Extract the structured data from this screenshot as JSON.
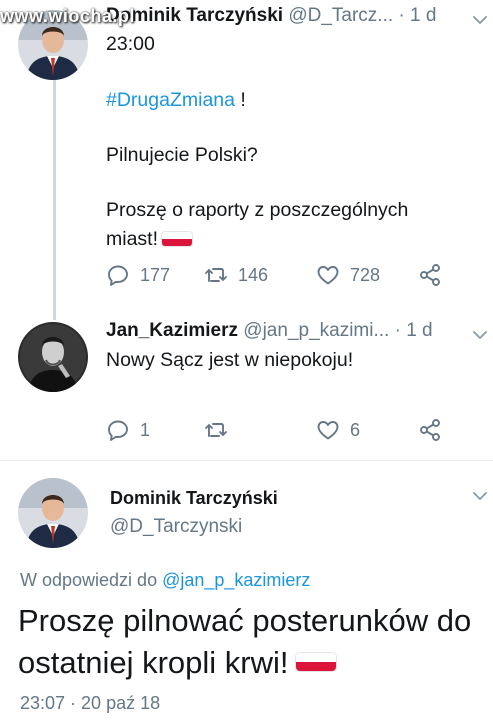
{
  "watermark": "www.wiocha.pl",
  "tweet1": {
    "name": "Dominik Tarczyński",
    "handle": "@D_Tarcz...",
    "age": "· 1 d",
    "time": "23:00",
    "hashtag": "#DrugaZmiana",
    "hashtag_suffix": " !",
    "line2": "Pilnujecie Polski?",
    "line3": "Proszę o raporty z poszczególnych",
    "line4": "miast!",
    "replies": "177",
    "retweets": "146",
    "likes": "728"
  },
  "tweet2": {
    "name": "Jan_Kazimierz",
    "handle": "@jan_p_kazimi...",
    "age": "· 1 d",
    "text": "Nowy Sącz jest w niepokoju!",
    "replies": "1",
    "retweets": "",
    "likes": "6"
  },
  "main_tweet": {
    "name": "Dominik Tarczyński",
    "handle": "@D_Tarczynski",
    "reply_prefix": "W odpowiedzi do ",
    "reply_to": "@jan_p_kazimierz",
    "line1": "Proszę pilnować posterunków do",
    "line2": "ostatniej kropli krwi!",
    "timestamp": "23:07 · 20 paź 18"
  },
  "icons": {
    "reply": "reply-icon",
    "retweet": "retweet-icon",
    "like": "heart-icon",
    "share": "share-icon",
    "menu": "chevron-down-icon"
  },
  "colors": {
    "link": "#1b95e0",
    "muted": "#657786",
    "flag_red": "#dc143c"
  }
}
